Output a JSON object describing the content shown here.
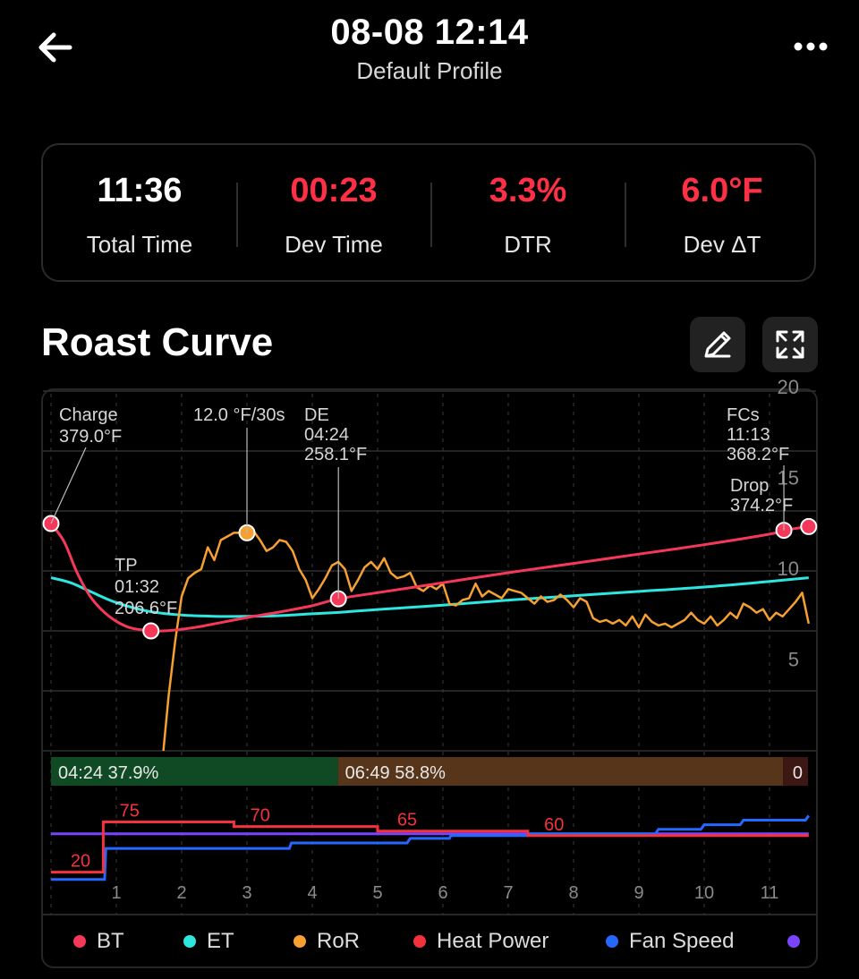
{
  "header": {
    "title": "08-08 12:14",
    "subtitle": "Default Profile"
  },
  "stats": [
    {
      "value": "11:36",
      "label": "Total Time",
      "color": "#ffffff"
    },
    {
      "value": "00:23",
      "label": "Dev Time",
      "color": "#ff3045"
    },
    {
      "value": "3.3%",
      "label": "DTR",
      "color": "#ff3045"
    },
    {
      "value": "6.0°F",
      "label": "Dev ΔT",
      "color": "#ff3045"
    }
  ],
  "section": {
    "title": "Roast Curve"
  },
  "colors": {
    "bt": "#f5385a",
    "et": "#2ee6e0",
    "ror": "#f5a031",
    "heat": "#f5323c",
    "fan": "#2468ff",
    "purple": "#7a44ff"
  },
  "chart_data": {
    "type": "line",
    "x_ticks": [
      "1",
      "2",
      "3",
      "4",
      "5",
      "6",
      "7",
      "8",
      "9",
      "10",
      "11"
    ],
    "xlim": [
      0,
      11.6
    ],
    "ror_axis_ticks": [
      "20",
      "15",
      "10",
      "5"
    ],
    "ror_ylim": [
      0,
      20
    ],
    "annotations": {
      "charge": {
        "name": "Charge",
        "value": "379.0°F"
      },
      "tp": {
        "name": "TP",
        "time": "01:32",
        "value": "206.6°F"
      },
      "ror_max": {
        "value": "12.0 °F/30s"
      },
      "de": {
        "name": "DE",
        "time": "04:24",
        "value": "258.1°F"
      },
      "fcs": {
        "name": "FCs",
        "time": "11:13",
        "value": "368.2°F"
      },
      "drop": {
        "name": "Drop",
        "value": "374.2°F"
      }
    },
    "series": [
      {
        "name": "BT",
        "x": [
          0,
          0.2,
          0.4,
          0.6,
          0.8,
          1.0,
          1.2,
          1.4,
          1.53,
          1.8,
          2.2,
          2.6,
          3.0,
          3.5,
          4.0,
          4.4,
          5.0,
          6.0,
          7.0,
          8.0,
          9.0,
          10.0,
          11.0,
          11.22,
          11.6
        ],
        "y": [
          379,
          350,
          300,
          262,
          238,
          222,
          212,
          208,
          206.6,
          207,
          212,
          220,
          228,
          237,
          247,
          258.1,
          268,
          284,
          300,
          315,
          330,
          345,
          362,
          368.2,
          374.2
        ]
      },
      {
        "name": "ET",
        "x": [
          0,
          0.3,
          0.6,
          1.0,
          1.5,
          2.0,
          2.5,
          3.0,
          3.5,
          4.0,
          4.5,
          5.0,
          6.0,
          7.0,
          8.0,
          9.0,
          10.0,
          11.0,
          11.6
        ],
        "y": [
          292,
          284,
          270,
          252,
          238,
          232,
          230,
          230,
          231,
          234,
          237,
          241,
          248,
          256,
          263,
          270,
          277,
          286,
          292
        ]
      },
      {
        "name": "RoR",
        "x": [
          1.72,
          1.8,
          1.9,
          2.0,
          2.1,
          2.2,
          2.3,
          2.4,
          2.5,
          2.6,
          2.7,
          2.8,
          2.9,
          3.0,
          3.1,
          3.2,
          3.3,
          3.4,
          3.5,
          3.6,
          3.7,
          3.8,
          3.9,
          4.0,
          4.1,
          4.2,
          4.3,
          4.4,
          4.5,
          4.6,
          4.7,
          4.8,
          4.9,
          5.0,
          5.1,
          5.2,
          5.3,
          5.4,
          5.5,
          5.6,
          5.7,
          5.8,
          5.9,
          6.0,
          6.1,
          6.2,
          6.3,
          6.4,
          6.5,
          6.6,
          6.7,
          6.8,
          6.9,
          7.0,
          7.1,
          7.2,
          7.3,
          7.4,
          7.5,
          7.6,
          7.7,
          7.8,
          7.9,
          8.0,
          8.1,
          8.2,
          8.3,
          8.4,
          8.5,
          8.6,
          8.7,
          8.8,
          8.9,
          9.0,
          9.1,
          9.2,
          9.3,
          9.4,
          9.5,
          9.6,
          9.7,
          9.8,
          9.9,
          10.0,
          10.1,
          10.2,
          10.3,
          10.4,
          10.5,
          10.6,
          10.7,
          10.8,
          10.9,
          11.0,
          11.1,
          11.2,
          11.3,
          11.4,
          11.5,
          11.6
        ],
        "y": [
          0,
          3,
          6,
          8.5,
          9.5,
          9.8,
          10,
          11.2,
          10.5,
          11.6,
          11.8,
          12.0,
          12.0,
          11.8,
          12.1,
          11.6,
          11.0,
          11.2,
          11.6,
          11.5,
          11.0,
          10.0,
          9.4,
          8.4,
          8.9,
          9.5,
          10.2,
          10.4,
          10.0,
          8.8,
          9.4,
          10.1,
          10.4,
          10.0,
          10.6,
          9.8,
          9.5,
          9.6,
          9.8,
          9.0,
          8.8,
          9.1,
          8.9,
          9.2,
          8.1,
          8.0,
          8.3,
          8.4,
          9.2,
          8.5,
          8.8,
          8.6,
          8.4,
          8.9,
          8.8,
          8.7,
          8.4,
          8.1,
          8.5,
          8.2,
          8.3,
          8.6,
          8.3,
          7.9,
          8.4,
          8.2,
          7.3,
          7.1,
          7.2,
          7.0,
          7.2,
          6.9,
          7.4,
          6.8,
          7.5,
          7.1,
          6.9,
          7.0,
          6.8,
          7.0,
          7.2,
          7.6,
          7.2,
          7.0,
          7.4,
          6.9,
          7.2,
          7.6,
          7.3,
          8.1,
          7.9,
          7.6,
          7.8,
          7.2,
          7.6,
          7.4,
          7.8,
          8.2,
          8.7,
          7.0
        ]
      },
      {
        "name": "Heat Power",
        "x": [
          0,
          0.8,
          0.8,
          2.8,
          2.8,
          5.0,
          5.0,
          7.3,
          7.3,
          11.6
        ],
        "y": [
          20,
          20,
          75,
          75,
          70,
          70,
          65,
          65,
          60,
          60
        ]
      },
      {
        "name": "Fan Speed",
        "x": [
          0,
          0.82,
          0.84,
          3.65,
          3.68,
          5.45,
          5.5,
          6.1,
          6.12,
          7.3,
          7.32,
          9.25,
          9.3,
          9.95,
          10.0,
          10.55,
          10.6,
          11.55,
          11.6
        ],
        "y": [
          12,
          12,
          46,
          46,
          52,
          52,
          57,
          57,
          60,
          60,
          62,
          62,
          67,
          67,
          72,
          72,
          77,
          77,
          82
        ]
      },
      {
        "name": "",
        "x": [
          0,
          11.6
        ],
        "y": [
          62,
          62
        ]
      }
    ],
    "heat_labels": [
      {
        "x": 0.3,
        "text": "20"
      },
      {
        "x": 1.05,
        "text": "75"
      },
      {
        "x": 3.05,
        "text": "70"
      },
      {
        "x": 5.3,
        "text": "65"
      },
      {
        "x": 7.55,
        "text": "60"
      }
    ],
    "phases": [
      {
        "label": "04:24 37.9%",
        "fraction": 0.379,
        "color": "#0f4a24"
      },
      {
        "label": "06:49 58.8%",
        "fraction": 0.588,
        "color": "#56351a"
      },
      {
        "label": "0",
        "fraction": 0.033,
        "color": "#3d1714"
      }
    ],
    "legend": [
      {
        "name": "BT",
        "color": "#f5385a"
      },
      {
        "name": "ET",
        "color": "#2ee6e0"
      },
      {
        "name": "RoR",
        "color": "#f5a031"
      },
      {
        "name": "Heat Power",
        "color": "#f5323c"
      },
      {
        "name": "Fan Speed",
        "color": "#2468ff"
      },
      {
        "name": "",
        "color": "#7a44ff"
      }
    ]
  }
}
